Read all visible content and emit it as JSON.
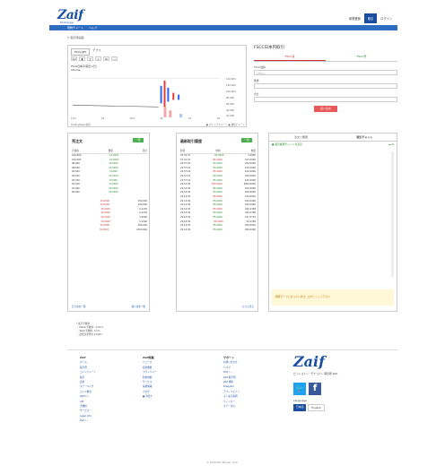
{
  "header": {
    "logo": "Zaif",
    "logo_sub": "Exchange",
    "links": [
      "新規登録",
      "ログイン"
    ],
    "active_link": "取引"
  },
  "nav": [
    "現物チャート",
    "ヘルプ"
  ],
  "breadcrumb": "✎ 取引所画面",
  "chart": {
    "pair": "FSCC/JPY",
    "tab2": "デプス",
    "info": "FSCC日本円 取引(1日)",
    "volume_label": "Volume",
    "price_ticks": [
      "140,000",
      "120,000",
      "100,000",
      "80,000",
      "60,000",
      "40,000",
      "20,000"
    ],
    "x_ticks": [
      "11/1",
      "16",
      "12/1",
      "16",
      "1/1",
      "16"
    ],
    "foot_left": "TradingView 提供",
    "foot_right": "● ステップチャート ● 通常チャート"
  },
  "order": {
    "title": "FSCC日本円取引",
    "tab_buy": "FSCC買",
    "tab_sell": "FSCC売",
    "label_price": "FSCC価格",
    "ph_price": "1FSCC...",
    "label_amount": "数量",
    "label_total": "合計",
    "button": "買い注文"
  },
  "asks": {
    "title": "売注文",
    "badge": "一括",
    "head": [
      "売価格",
      "数量",
      "累計"
    ],
    "rows": [
      [
        "102,000",
        "10.0000",
        ""
      ],
      [
        "100,000",
        "20.0000",
        ""
      ],
      [
        "98,000",
        "10.0000",
        ""
      ],
      [
        "96,500",
        "12.0000",
        ""
      ],
      [
        "95,000",
        "5.0000",
        ""
      ],
      [
        "94,000",
        "10.0000",
        ""
      ],
      [
        "93,700",
        "8.0000",
        ""
      ],
      [
        "92,500",
        "10.0000",
        ""
      ],
      [
        "91,000",
        "10.0000",
        ""
      ],
      [
        "90,000",
        "20.0000",
        ""
      ],
      [
        "",
        "",
        ""
      ],
      [
        "",
        "20.0000",
        "150,000"
      ],
      [
        "",
        "20.0000",
        "100,000"
      ],
      [
        "",
        "30.0000",
        "0.1234"
      ],
      [
        "",
        "20.0000",
        "0.1234"
      ],
      [
        "",
        "20.0000",
        "3.0000"
      ],
      [
        "",
        "20.0000",
        "0.1000"
      ],
      [
        "",
        "20.0000",
        "500,000"
      ],
      [
        "",
        "30.0000",
        "1200,000"
      ]
    ],
    "foot_left": "売り注文一覧",
    "foot_right": "買い注文一覧"
  },
  "trades": {
    "title": "最新取引履歴",
    "badge": "一括",
    "head": [
      "時間",
      "価格",
      "数量"
    ],
    "rows": [
      [
        "07:31:37",
        "85,0000",
        "2.0000"
      ],
      [
        "07:31:37",
        "85,0000",
        "517.0000"
      ],
      [
        "22:57:25",
        "85,0000",
        "200.0000"
      ],
      [
        "22:57:16",
        "83,0000",
        "100.0000"
      ],
      [
        "22:57:16",
        "85,0000",
        "100.0000"
      ],
      [
        "22:57:16",
        "85,0000",
        "100.0000"
      ],
      [
        "22:57:16",
        "85,0000",
        "100.0000"
      ],
      [
        "22:14:30",
        "100.0000",
        "3000.0000"
      ],
      [
        "22:14:30",
        "85,0000",
        "100.0000"
      ],
      [
        "22:14:30",
        "85,0000",
        "500.0000"
      ],
      [
        "22:14:30",
        "85,0000",
        "100.0000"
      ],
      [
        "22:14:30",
        "85,0000",
        "100.0000"
      ],
      [
        "22:14:30",
        "85,0000",
        "100.0000"
      ],
      [
        "22:14:30",
        "85,0000",
        "445.2798"
      ],
      [
        "22:14:30",
        "85,0000",
        "445.2798"
      ],
      [
        "22:14:30",
        "85,0000",
        "197.5724"
      ],
      [
        "22:14:30",
        "85,0000",
        "64.2798"
      ],
      [
        "22:14:30",
        "85,0000",
        "200.0000"
      ],
      [
        "22:14:30",
        "85,0000",
        "200.0000"
      ]
    ],
    "foot_right": "もっと見る"
  },
  "chat": {
    "tab1": "注文と履歴",
    "tab2": "取引チャット",
    "tool": "● 取引履歴チャットを表示",
    "note": "閲覧モードになっています。ログインして下さい"
  },
  "notes": [
    "* 取引手数料",
    "・ Maker手数料: -0.01%",
    "・ Taker手数料: 0.1%",
    "・ 最低注文単位 0.0001"
  ],
  "footer": {
    "col1_title": "Zaif",
    "col1": [
      "ホーム",
      "取引所",
      "コインチャート",
      "取引",
      "送金",
      "ステーキング",
      "コイン積立",
      "Zaifペイ",
      "API",
      "手数料",
      "サービス",
      "Legal Info",
      "Zaif / ..."
    ],
    "col2_title": "Zaif関連",
    "col2": [
      "ニュース",
      "会社概要",
      "プライバシー",
      "利用規約",
      "サービス",
      "採用情報",
      "ブログ",
      "● 手続き"
    ],
    "col3_title": "サポート",
    "col3": [
      "お問い合わせ",
      "ヘルプ",
      "FAQ / ...",
      "Zaif 取引所",
      "Zaif 資料",
      "Telegram",
      "アフィリエイト",
      "よくある質問",
      "ティッカー",
      "ステータス"
    ],
    "tag": "ビットコイン・モナコイン 取引所 Zaif",
    "lang_label": "Language",
    "lang_on": "日本語",
    "lang_off": "English",
    "copyright": "© 2018 Tech Bureau, Corp."
  }
}
